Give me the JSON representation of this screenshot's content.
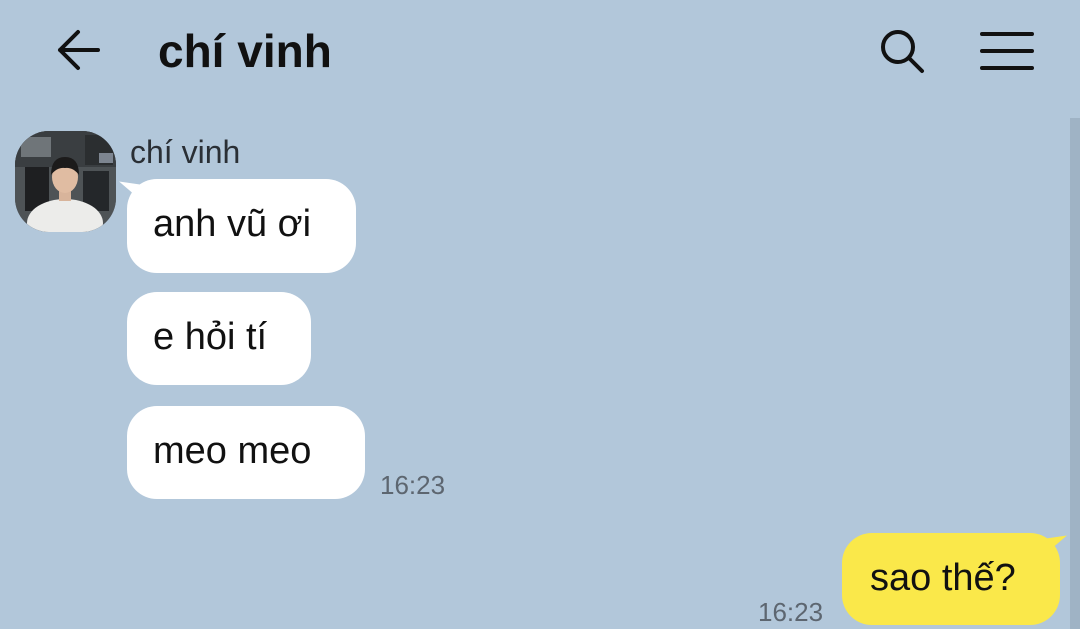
{
  "header": {
    "title": "chí vinh",
    "back_icon": "arrow-left-icon",
    "search_icon": "search-icon",
    "menu_icon": "hamburger-menu-icon"
  },
  "conversation": {
    "contact": {
      "name": "chí vinh",
      "avatar": "user-avatar"
    },
    "incoming_messages": [
      {
        "text": "anh vũ ơi"
      },
      {
        "text": "e hỏi tí"
      },
      {
        "text": "meo meo",
        "time": "16:23"
      }
    ],
    "outgoing_messages": [
      {
        "text": "sao thế?",
        "time": "16:23"
      }
    ]
  },
  "colors": {
    "background": "#b2c7da",
    "incoming_bubble": "#ffffff",
    "outgoing_bubble": "#fae84a",
    "timestamp": "#5d6670"
  }
}
